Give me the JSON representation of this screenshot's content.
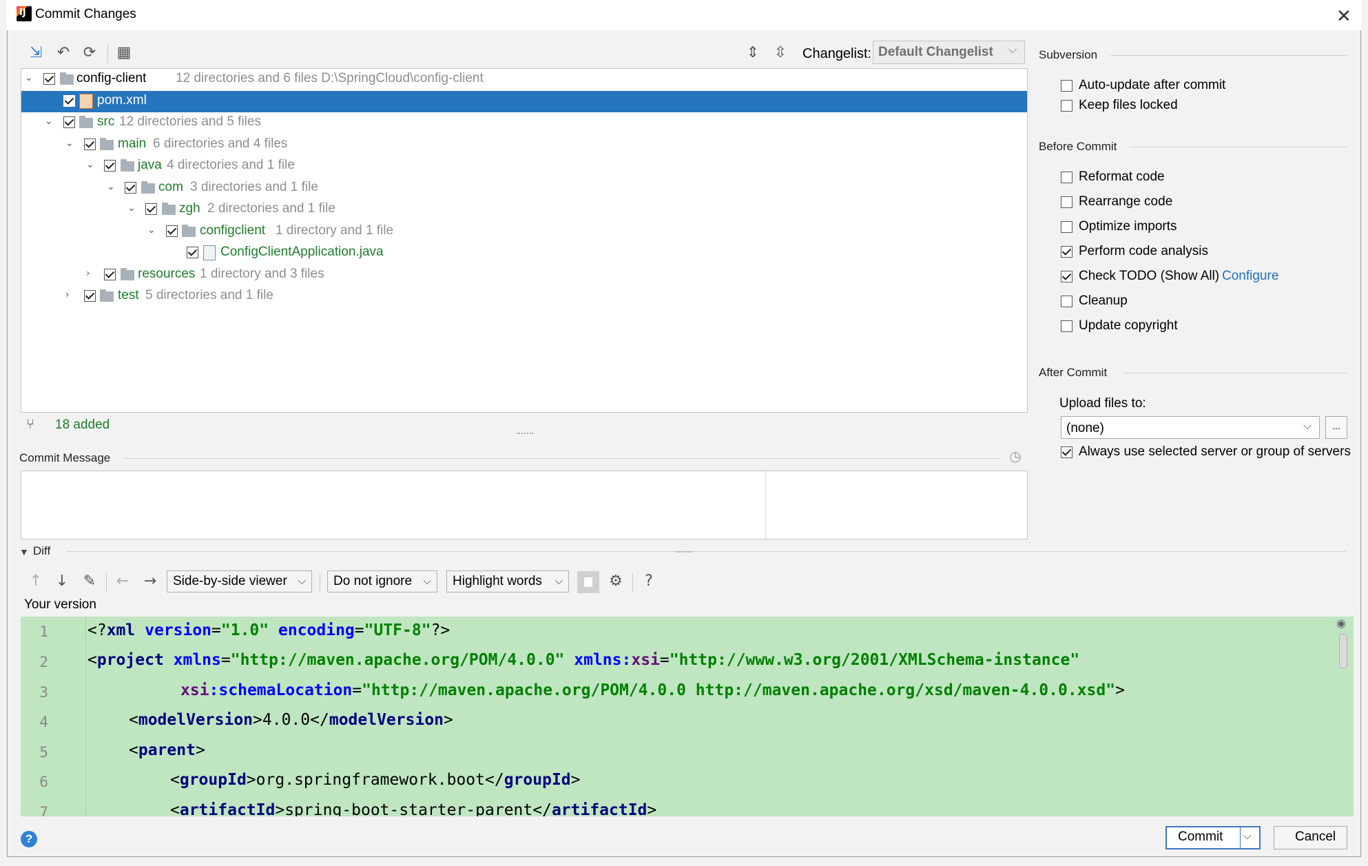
{
  "window": {
    "title": "Commit Changes"
  },
  "toolbar": {
    "changelist_label": "Changelist:",
    "changelist_value": "Default Changelist"
  },
  "tree": {
    "rows": [
      {
        "name": "config-client",
        "info": "12 directories and 6 files  D:\\SpringCloud\\config-client"
      },
      {
        "name": "pom.xml",
        "info": ""
      },
      {
        "name": "src",
        "info": "12 directories and 5 files"
      },
      {
        "name": "main",
        "info": "6 directories and 4 files"
      },
      {
        "name": "java",
        "info": "4 directories and 1 file"
      },
      {
        "name": "com",
        "info": "3 directories and 1 file"
      },
      {
        "name": "zgh",
        "info": "2 directories and 1 file"
      },
      {
        "name": "configclient",
        "info": "1 directory and 1 file"
      },
      {
        "name": "ConfigClientApplication.java",
        "info": ""
      },
      {
        "name": "resources",
        "info": "1 directory and 3 files"
      },
      {
        "name": "test",
        "info": "5 directories and 1 file"
      }
    ],
    "status": "18 added"
  },
  "commit_message": {
    "label": "Commit Message",
    "value": ""
  },
  "subversion": {
    "heading": "Subversion",
    "options": [
      {
        "label": "Auto-update after commit",
        "checked": false
      },
      {
        "label": "Keep files locked",
        "checked": false
      }
    ]
  },
  "before_commit": {
    "heading": "Before Commit",
    "options": [
      {
        "label": "Reformat code",
        "checked": false
      },
      {
        "label": "Rearrange code",
        "checked": false
      },
      {
        "label": "Optimize imports",
        "checked": false
      },
      {
        "label": "Perform code analysis",
        "checked": true
      },
      {
        "label": "Check TODO (Show All)",
        "checked": true,
        "link": "Configure"
      },
      {
        "label": "Cleanup",
        "checked": false
      },
      {
        "label": "Update copyright",
        "checked": false
      }
    ]
  },
  "after_commit": {
    "heading": "After Commit",
    "upload_label": "Upload files to:",
    "upload_value": "(none)",
    "more_button": "...",
    "always_use": {
      "label": "Always use selected server or group of servers",
      "checked": true
    }
  },
  "diff": {
    "heading": "Diff",
    "viewer": "Side-by-side viewer",
    "ignore": "Do not ignore",
    "highlight": "Highlight words",
    "help": "?",
    "your_version": "Your version",
    "line_numbers": [
      "1",
      "2",
      "3",
      "4",
      "5",
      "6",
      "7"
    ],
    "lines": {
      "l1": {
        "p1": "<?",
        "tag": "xml",
        "a1": " version",
        "eq1": "=",
        "s1": "\"1.0\"",
        "a2": " encoding",
        "eq2": "=",
        "s2": "\"UTF-8\"",
        "end": "?>"
      },
      "l2": {
        "open": "<",
        "tag": "project",
        "a1": " xmlns",
        "eq1": "=",
        "s1": "\"http://maven.apache.org/POM/4.0.0\"",
        "a2": " xmlns",
        "c2": ":",
        "ns2": "xsi",
        "eq2": "=",
        "s2": "\"http://www.w3.org/2001/XMLSchema-instance\""
      },
      "l3": {
        "ns": "xsi",
        "c": ":",
        "attr": "schemaLocation",
        "eq": "=",
        "s": "\"http://maven.apache.org/POM/4.0.0 http://maven.apache.org/xsd/maven-4.0.0.xsd\"",
        "end": ">"
      },
      "l4": {
        "open": "<",
        "tag": "modelVersion",
        "close1": ">",
        "text": "4.0.0",
        "open2": "</",
        "tag2": "modelVersion",
        "close2": ">"
      },
      "l5": {
        "open": "<",
        "tag": "parent",
        "close": ">"
      },
      "l6": {
        "open": "<",
        "tag": "groupId",
        "close1": ">",
        "text": "org.springframework.boot",
        "open2": "</",
        "tag2": "groupId",
        "close2": ">"
      },
      "l7": {
        "open": "<",
        "tag": "artifactId",
        "close1": ">",
        "text": "spring-boot-starter-parent",
        "open2": "</",
        "tag2": "artifactId",
        "close2": ">"
      }
    }
  },
  "buttons": {
    "commit": "Commit",
    "cancel": "Cancel",
    "help": "?"
  }
}
